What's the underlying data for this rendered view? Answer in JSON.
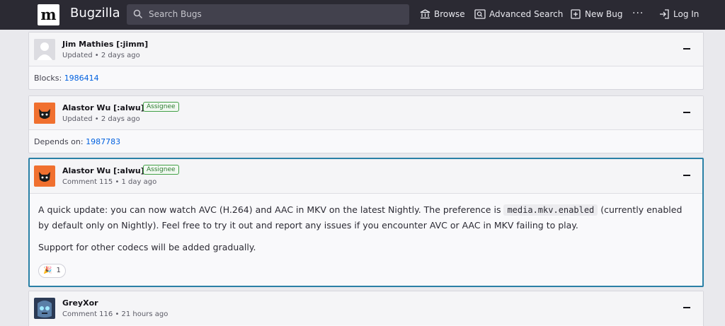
{
  "header": {
    "logo_letter": "m",
    "brand": "Bugzilla",
    "search_placeholder": "Search Bugs",
    "nav": {
      "browse": "Browse",
      "advanced_search": "Advanced Search",
      "new_bug": "New Bug",
      "more": "···",
      "login": "Log In"
    }
  },
  "cards": [
    {
      "user": "Jim Mathies [:jimm]",
      "meta": "Updated • 2 days ago",
      "body_label": "Blocks:",
      "body_link": "1986414"
    },
    {
      "user": "Alastor Wu [:alwu]",
      "badge": "Assignee",
      "meta": "Updated • 2 days ago",
      "body_label": "Depends on:",
      "body_link": "1987783"
    },
    {
      "user": "Alastor Wu [:alwu]",
      "badge": "Assignee",
      "meta": "Comment 115 • 1 day ago",
      "text_before": "A quick update: you can now watch AVC (H.264) and AAC in MKV on the latest Nightly. The preference is",
      "code": "media.mkv.enabled",
      "text_after": "(currently enabled by default only on Nightly). Feel free to try it out and report any issues if you encounter AVC or AAC in MKV failing to play.",
      "paragraph2": "Support for other codecs will be added gradually.",
      "reaction_emoji": "🎉",
      "reaction_count": "1"
    },
    {
      "user": "GreyXor",
      "meta": "Comment 116 • 21 hours ago"
    }
  ],
  "colors": {
    "header_bg": "#2b2a33",
    "link": "#0060df",
    "active_border": "#2a80a6",
    "badge_green": "#2e7d32"
  },
  "icons": [
    "search-icon",
    "browse-icon",
    "advanced-search-icon",
    "new-bug-icon",
    "more-icon",
    "login-icon",
    "collapse-icon"
  ]
}
